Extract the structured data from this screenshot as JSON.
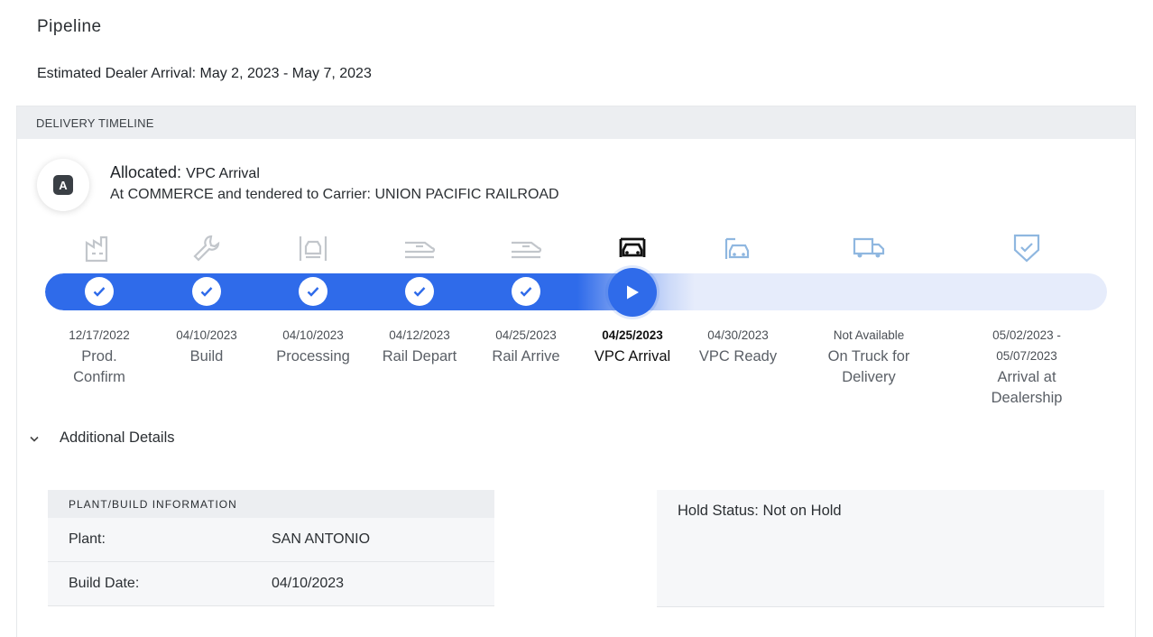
{
  "page": {
    "title": "Pipeline",
    "eta": "Estimated Dealer Arrival: May 2, 2023 - May 7, 2023"
  },
  "timeline": {
    "header": "DELIVERY TIMELINE",
    "badge_letter": "A",
    "status_label": "Allocated:",
    "status_value": "VPC Arrival",
    "status_desc": "At COMMERCE and tendered to Carrier: UNION PACIFIC RAILROAD",
    "progress_fraction": 0.56,
    "accent_color": "#2f6bea",
    "steps": [
      {
        "date": "12/17/2022",
        "label1": "Prod.",
        "label2": "Confirm",
        "icon": "factory-icon",
        "state": "done"
      },
      {
        "date": "04/10/2023",
        "label1": "Build",
        "label2": "",
        "icon": "wrench-icon",
        "state": "done"
      },
      {
        "date": "04/10/2023",
        "label1": "Processing",
        "label2": "",
        "icon": "processing-icon",
        "state": "done"
      },
      {
        "date": "04/12/2023",
        "label1": "Rail Depart",
        "label2": "",
        "icon": "train-depart-icon",
        "state": "done"
      },
      {
        "date": "04/25/2023",
        "label1": "Rail Arrive",
        "label2": "",
        "icon": "train-arrive-icon",
        "state": "done"
      },
      {
        "date": "04/25/2023",
        "label1": "VPC Arrival",
        "label2": "",
        "icon": "car-arrival-icon",
        "state": "current"
      },
      {
        "date": "04/30/2023",
        "label1": "VPC Ready",
        "label2": "",
        "icon": "car-ready-icon",
        "state": "upcoming"
      },
      {
        "date": "Not Available",
        "label1": "On Truck for",
        "label2": "Delivery",
        "icon": "truck-icon",
        "state": "upcoming"
      },
      {
        "date": "05/02/2023 -",
        "date2": "05/07/2023",
        "label1": "Arrival at",
        "label2": "Dealership",
        "icon": "shield-check-icon",
        "state": "upcoming"
      }
    ]
  },
  "details": {
    "toggle_label": "Additional Details",
    "plant_header": "PLANT/BUILD INFORMATION",
    "plant_label": "Plant:",
    "plant_value": "SAN ANTONIO",
    "build_date_label": "Build Date:",
    "build_date_value": "04/10/2023",
    "hold_status": "Hold Status: Not on Hold"
  }
}
